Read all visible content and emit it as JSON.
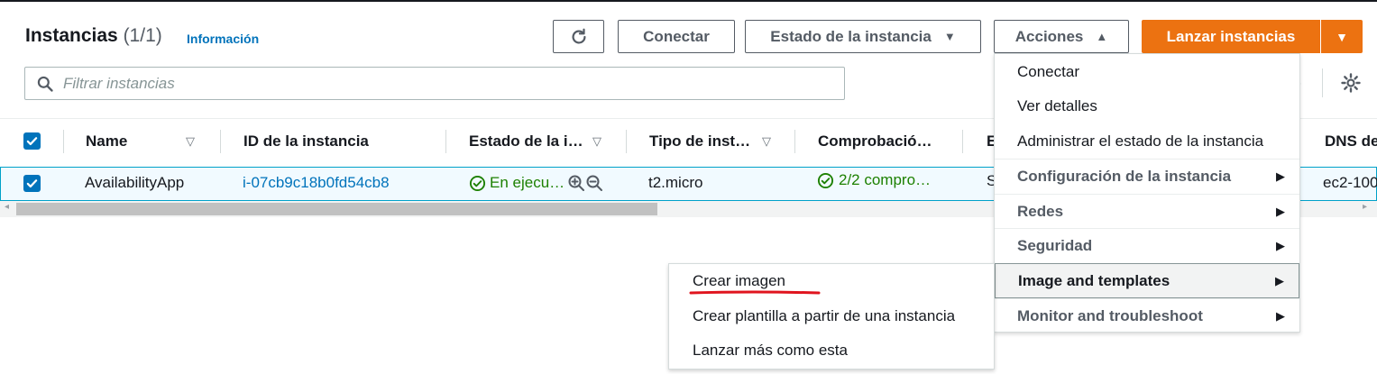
{
  "header": {
    "title": "Instancias",
    "count": "(1/1)",
    "info_link": "Información"
  },
  "toolbar": {
    "refresh_icon": "refresh-icon",
    "connect_label": "Conectar",
    "instance_state_label": "Estado de la instancia",
    "actions_label": "Acciones",
    "launch_label": "Lanzar instancias"
  },
  "filter": {
    "placeholder": "Filtrar instancias"
  },
  "table": {
    "columns": [
      "Name",
      "ID de la instancia",
      "Estado de la i…",
      "Tipo de inst…",
      "Comprobació…",
      "E",
      "DNS de"
    ],
    "rows": [
      {
        "name": "AvailabilityApp",
        "instance_id": "i-07cb9c18b0fd54cb8",
        "state": "En ejecu…",
        "type": "t2.micro",
        "checks": "2/2 compro…",
        "col_e": "S",
        "dns": "ec2-100"
      }
    ]
  },
  "actions_menu": {
    "items": [
      "Conectar",
      "Ver detalles",
      "Administrar el estado de la instancia"
    ],
    "groups": [
      "Configuración de la instancia",
      "Redes",
      "Seguridad",
      "Image and templates",
      "Monitor and troubleshoot"
    ]
  },
  "submenu": {
    "items": [
      "Crear imagen",
      "Crear plantilla a partir de una instancia",
      "Lanzar más como esta"
    ]
  },
  "colors": {
    "accent_orange": "#ec7211",
    "link_blue": "#0073bb",
    "success_green": "#1d8102",
    "annotation_red": "#e0141e"
  }
}
